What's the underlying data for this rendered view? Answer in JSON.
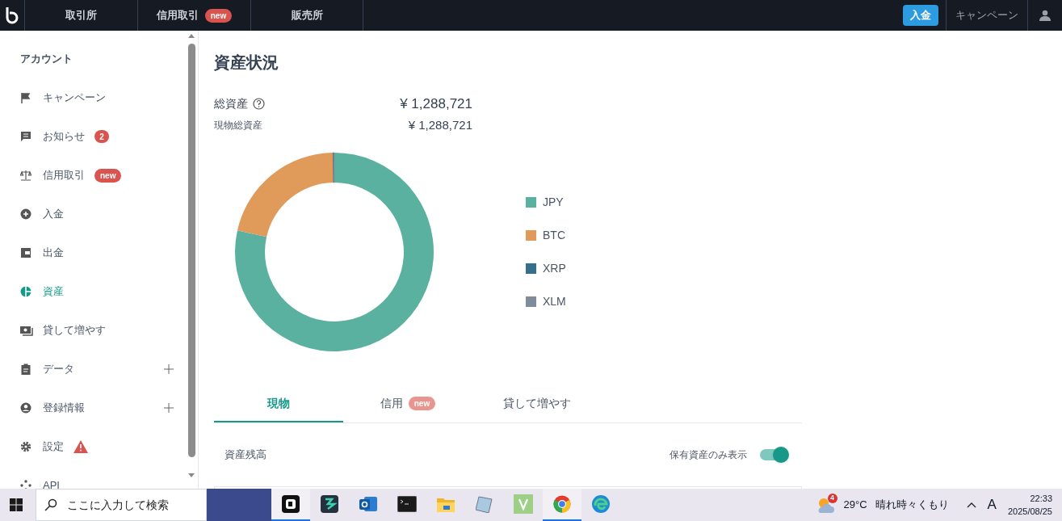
{
  "top_bar": {
    "tabs": [
      {
        "label": "取引所"
      },
      {
        "label": "信用取引",
        "badge": "new"
      },
      {
        "label": "販売所"
      }
    ],
    "deposit_button": "入金",
    "campaign_link": "キャンペーン"
  },
  "sidebar": {
    "heading": "アカウント",
    "items": [
      {
        "label": "キャンペーン",
        "selected": false,
        "warning": false
      },
      {
        "label": "お知らせ",
        "badge": "2",
        "selected": false,
        "warning": false
      },
      {
        "label": "信用取引",
        "badge": "new",
        "selected": false,
        "warning": false
      },
      {
        "label": "入金",
        "selected": false,
        "warning": false
      },
      {
        "label": "出金",
        "selected": false,
        "warning": false
      },
      {
        "label": "資産",
        "selected": true,
        "warning": false
      },
      {
        "label": "貸して増やす",
        "selected": false,
        "warning": false
      },
      {
        "label": "データ",
        "selected": false,
        "warning": false,
        "expanded": false
      },
      {
        "label": "登録情報",
        "selected": false,
        "warning": false,
        "expanded": false
      },
      {
        "label": "設定",
        "selected": false,
        "warning": true
      },
      {
        "label": "API",
        "selected": false,
        "warning": false
      }
    ]
  },
  "main": {
    "title": "資産状況",
    "total": {
      "label": "総資産",
      "value": "¥ 1,288,721"
    },
    "spot_total": {
      "label": "現物総資産",
      "value": "¥ 1,288,721"
    },
    "legend": [
      {
        "label": "JPY",
        "color": "#5bb1a0"
      },
      {
        "label": "BTC",
        "color": "#e09a5a"
      },
      {
        "label": "XRP",
        "color": "#356f8c"
      },
      {
        "label": "XLM",
        "color": "#7f8c99"
      }
    ],
    "tabs": [
      {
        "label": "現物",
        "selected": true
      },
      {
        "label": "信用",
        "badge": "new",
        "selected": false
      },
      {
        "label": "貸して増やす",
        "selected": false
      }
    ],
    "balance_label": "資産残高",
    "holdings_toggle": {
      "label": "保有資産のみ表示",
      "on": true
    }
  },
  "taskbar": {
    "search_placeholder": "ここに入力して検索",
    "apps": [
      {
        "running": true
      },
      {
        "running": false
      },
      {
        "running": false
      },
      {
        "running": false
      },
      {
        "running": false
      },
      {
        "running": false
      },
      {
        "running": false
      },
      {
        "running": true
      },
      {
        "running": false
      }
    ],
    "weather_badge": "4",
    "temperature": "29°C",
    "weather": "晴れ時々くもり",
    "ime": "A",
    "time": "22:33",
    "date": "2025/08/25"
  }
}
